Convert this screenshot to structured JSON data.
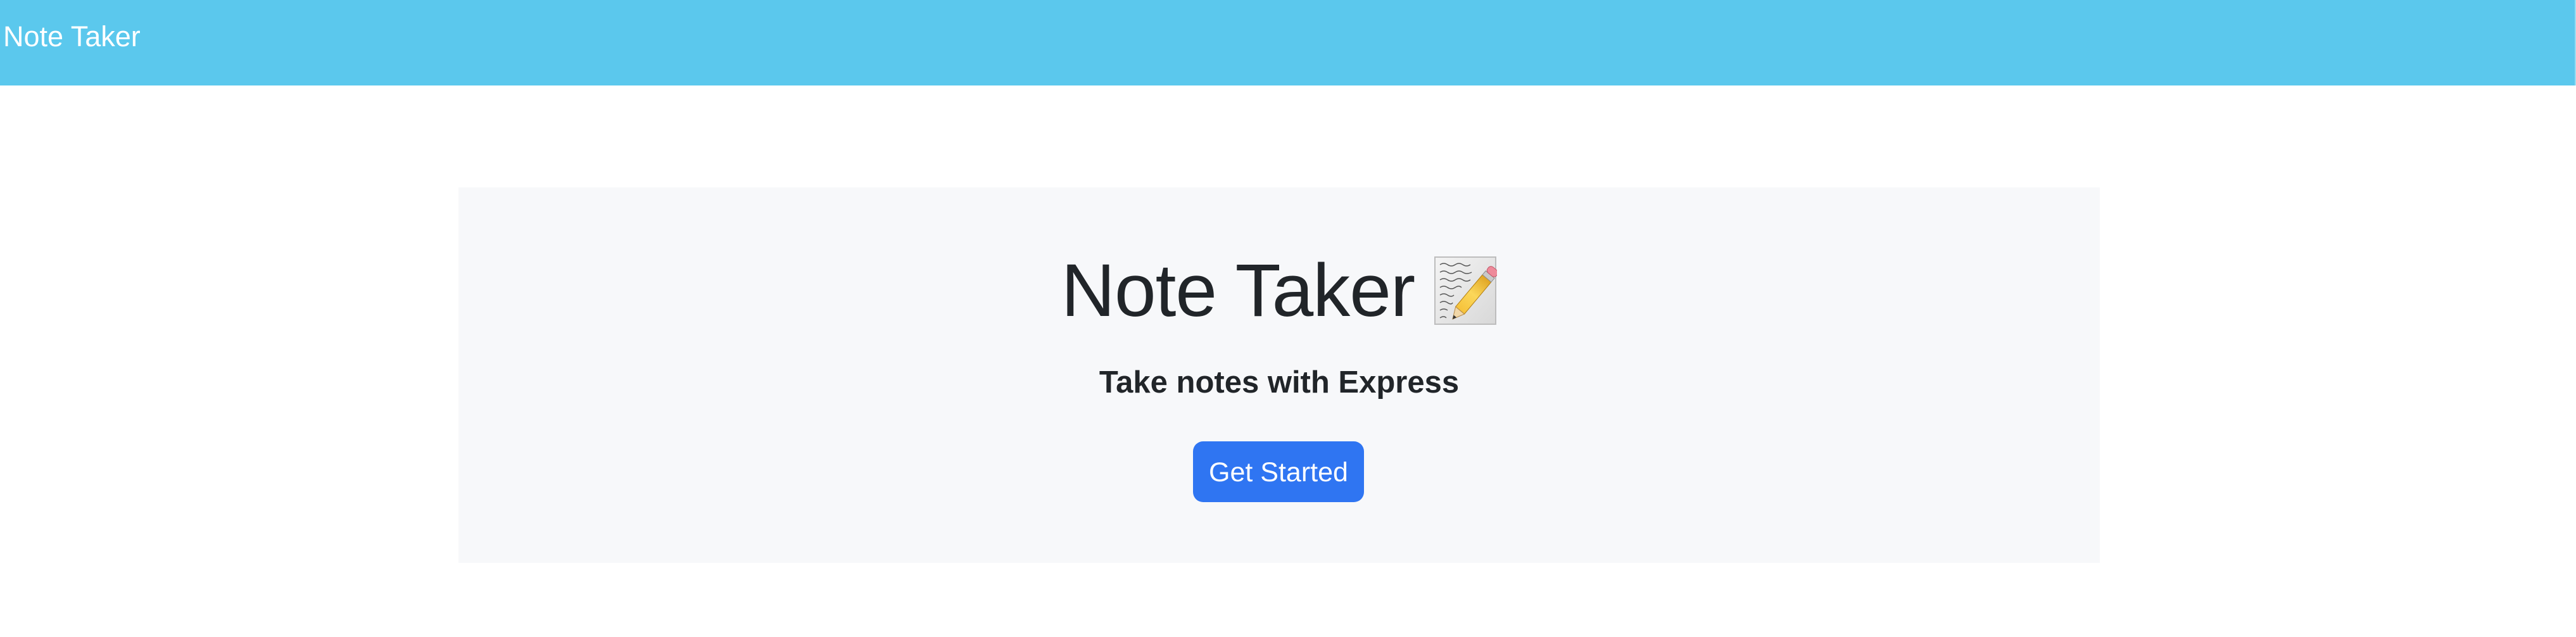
{
  "navbar": {
    "brand": "Note Taker",
    "background_color": "#5bc8ed"
  },
  "hero": {
    "title": "Note Taker",
    "title_icon": "memo-pencil-icon",
    "subtitle": "Take notes with Express",
    "cta_label": "Get Started",
    "cta_color": "#2f75f2",
    "background_color": "#f7f8fa"
  }
}
